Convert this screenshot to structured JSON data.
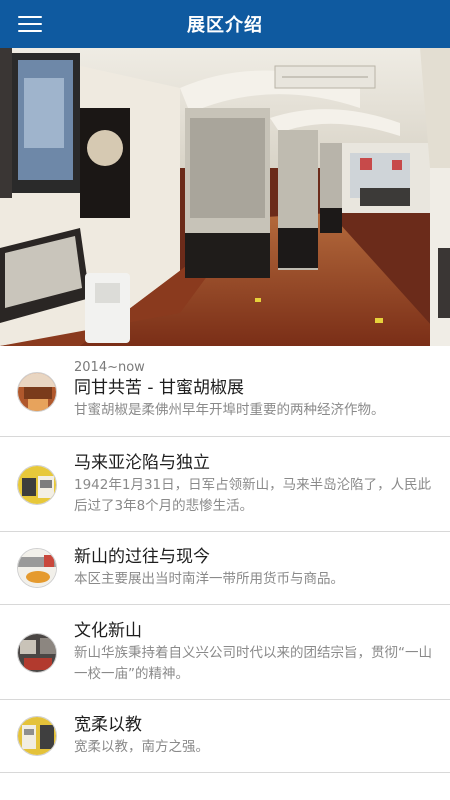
{
  "header": {
    "title": "展区介绍",
    "menu_icon": "hamburger-menu-icon",
    "background_color": "#0f5aa0"
  },
  "hero": {
    "image": "exhibition-hall-photo"
  },
  "exhibits": [
    {
      "tag": "2014~now",
      "title": "同甘共苦 - 甘蜜胡椒展",
      "description": "甘蜜胡椒是柔佛州早年开埠时重要的两种经济作物。",
      "thumbnail": "gambier-pepper-thumbnail"
    },
    {
      "title": "马来亚沦陷与独立",
      "description": "1942年1月31日，日军占领新山，马来半岛沦陷了，人民此后过了3年8个月的悲惨生活。",
      "thumbnail": "occupation-thumbnail"
    },
    {
      "title": "新山的过往与现今",
      "description": "本区主要展出当时南洋一带所用货币与商品。",
      "thumbnail": "currency-thumbnail"
    },
    {
      "title": "文化新山",
      "description": "新山华族秉持着自义兴公司时代以来的团结宗旨，贯彻“一山一校一庙”的精神。",
      "thumbnail": "culture-thumbnail"
    },
    {
      "title": "宽柔以教",
      "description": "宽柔以教，南方之强。",
      "thumbnail": "education-thumbnail"
    }
  ]
}
